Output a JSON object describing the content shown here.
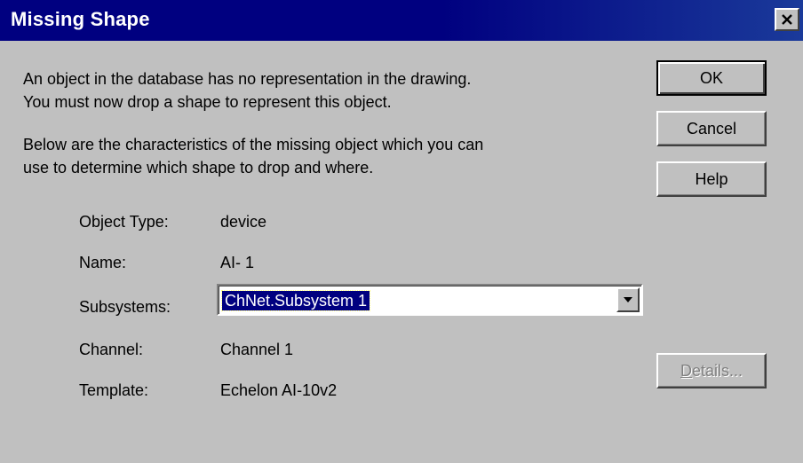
{
  "window": {
    "title": "Missing Shape"
  },
  "message": {
    "line1": "An object in the database has no representation in the drawing.",
    "line2": "You must now drop a shape to represent this object.",
    "line3": "Below are the characteristics of the missing object which you can",
    "line4": "use to determine which shape to drop and where."
  },
  "fields": {
    "object_type_label": "Object Type:",
    "object_type_value": "device",
    "name_label": "Name:",
    "name_value": "AI- 1",
    "subsystems_label": "Subsystems:",
    "subsystems_value": "ChNet.Subsystem 1",
    "channel_label": "Channel:",
    "channel_value": "Channel 1",
    "template_label": "Template:",
    "template_value": "Echelon AI-10v2"
  },
  "buttons": {
    "ok": "OK",
    "cancel": "Cancel",
    "help": "Help",
    "details_first": "D",
    "details_rest": "etails..."
  },
  "icons": {
    "close": "close-icon",
    "dropdown": "chevron-down-icon"
  },
  "colors": {
    "titlebar": "#000080",
    "dialog_bg": "#c0c0c0",
    "selection": "#000080"
  }
}
